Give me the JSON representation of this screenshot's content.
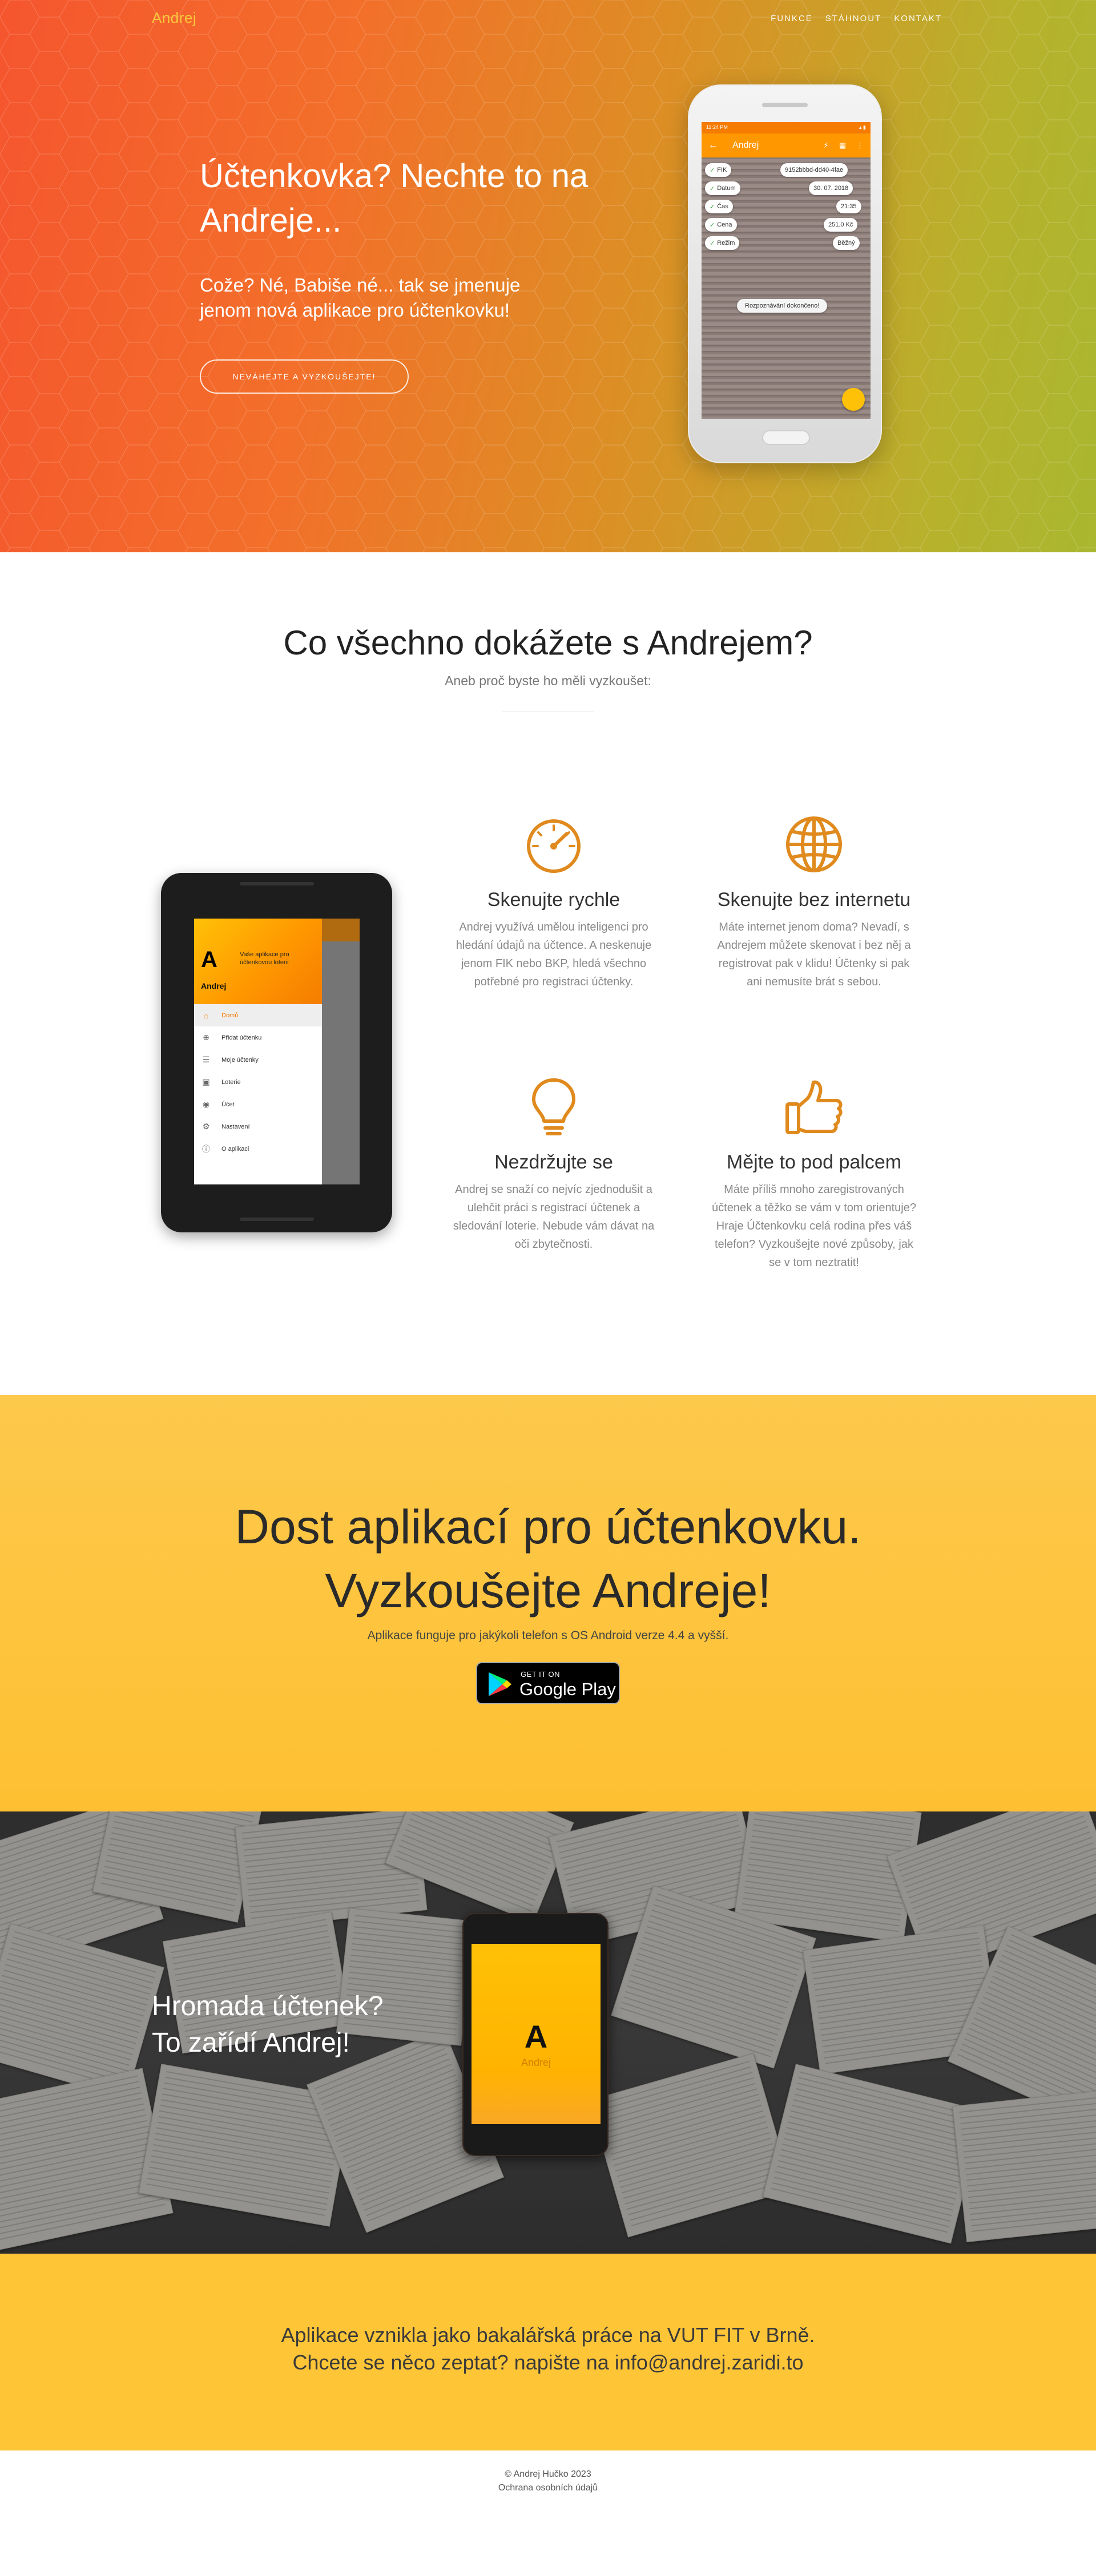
{
  "nav": {
    "brand": "Andrej",
    "links": [
      "FUNKCE",
      "STÁHNOUT",
      "KONTAKT"
    ]
  },
  "hero": {
    "title": "Účtenkovka? Nechte to na Andreje...",
    "subtitle": "Cože? Né, Babiše né... tak se jmenuje jenom nová aplikace pro účtenkovku!",
    "button": "NEVÁHEJTE A VYZKOUŠEJTE!",
    "phone": {
      "status_time": "11:24 PM",
      "app_title": "Andrej",
      "fields": [
        {
          "label": "FIK",
          "value": "9152bbbd-dd40-4fae"
        },
        {
          "label": "Datum",
          "value": "30. 07. 2018"
        },
        {
          "label": "Čas",
          "value": "21:35"
        },
        {
          "label": "Cena",
          "value": "251.0 Kč"
        },
        {
          "label": "Režim",
          "value": "Běžný"
        }
      ],
      "confirm": "Rozpoznávání dokončeno!"
    }
  },
  "features": {
    "title": "Co všechno dokážete s Andrejem?",
    "subtitle": "Aneb proč byste ho měli vyzkoušet:",
    "items": [
      {
        "icon": "speedometer-icon",
        "title": "Skenujte rychle",
        "text": "Andrej využívá umělou inteligenci pro hledání údajů na účtence. A neskenuje jenom FIK nebo BKP, hledá všechno potřebné pro registraci účtenky."
      },
      {
        "icon": "globe-icon",
        "title": "Skenujte bez internetu",
        "text": "Máte internet jenom doma? Nevadí, s Andrejem můžete skenovat i bez něj a registrovat pak v klidu! Účtenky si pak ani nemusíte brát s sebou."
      },
      {
        "icon": "lightbulb-icon",
        "title": "Nezdržujte se",
        "text": "Andrej se snaží co nejvíc zjednodušit a ulehčit práci s registrací účtenek a sledování loterie. Nebude vám dávat na oči zbytečnosti."
      },
      {
        "icon": "thumbs-up-icon",
        "title": "Mějte to pod palcem",
        "text": "Máte příliš mnoho zaregistrovaných účtenek a těžko se vám v tom orientuje? Hraje Účtenkovku celá rodina přes váš telefon? Vyzkoušejte nové způsoby, jak se v tom neztratit!"
      }
    ],
    "tablet": {
      "app_name": "Andrej",
      "tagline": "Vaše aplikace pro účtenkovou loterii",
      "menu": [
        "Domů",
        "Přidat účtenku",
        "Moje účtenky",
        "Loterie",
        "Účet",
        "Nastavení",
        "O aplikaci"
      ]
    }
  },
  "cta": {
    "line1": "Dost aplikací pro účtenkovku.",
    "line2": "Vyzkoušejte Andreje!",
    "note": "Aplikace funguje pro jakýkoli telefon s OS Android verze 4.4 a vyšší.",
    "store_small": "GET IT ON",
    "store_big": "Google Play"
  },
  "photo": {
    "line1": "Hromada účtenek?",
    "line2": "To zařídí Andrej!",
    "phone_logo": "A",
    "phone_name": "Andrej"
  },
  "info": {
    "line1": "Aplikace vznikla jako bakalářská práce na VUT FIT v Brně.",
    "line2": "Chcete se něco zeptat? napište na info@andrej.zaridi.to"
  },
  "footer": {
    "copyright": "© Andrej Hučko 2023",
    "privacy": "Ochrana osobních údajů"
  },
  "colors": {
    "hero_start": "#f5552e",
    "hero_end": "#a9b72f",
    "accent_orange": "#e08a1e",
    "cta_yellow": "#fec537"
  }
}
